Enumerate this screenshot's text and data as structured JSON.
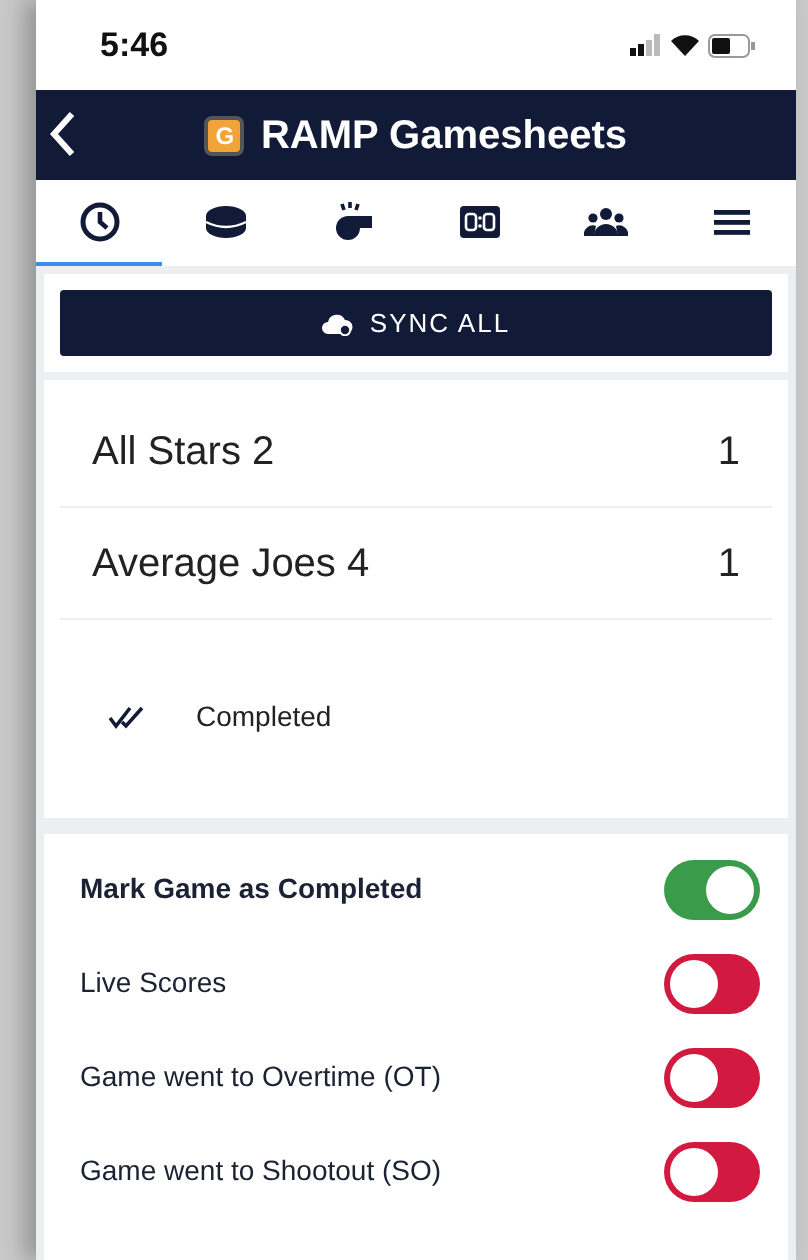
{
  "status_bar": {
    "time": "5:46"
  },
  "header": {
    "title": "RAMP Gamesheets",
    "logo": "G"
  },
  "tabs": [
    {
      "kind": "clock",
      "selected": true
    },
    {
      "kind": "puck",
      "selected": false
    },
    {
      "kind": "whistle",
      "selected": false
    },
    {
      "kind": "scoreboard",
      "selected": false
    },
    {
      "kind": "people",
      "selected": false
    },
    {
      "kind": "menu",
      "selected": false
    }
  ],
  "sync_button": {
    "label": "SYNC ALL"
  },
  "teams": [
    {
      "name": "All Stars 2",
      "score": "1"
    },
    {
      "name": "Average Joes 4",
      "score": "1"
    }
  ],
  "game_status": {
    "label": "Completed"
  },
  "toggles": [
    {
      "label": "Mark Game as Completed",
      "kind": "primary",
      "on": true
    },
    {
      "label": "Live Scores",
      "kind": "option",
      "on": false
    },
    {
      "label": "Game went to Overtime (OT)",
      "kind": "option",
      "on": false
    },
    {
      "label": "Game went to Shootout (SO)",
      "kind": "option",
      "on": false
    }
  ]
}
